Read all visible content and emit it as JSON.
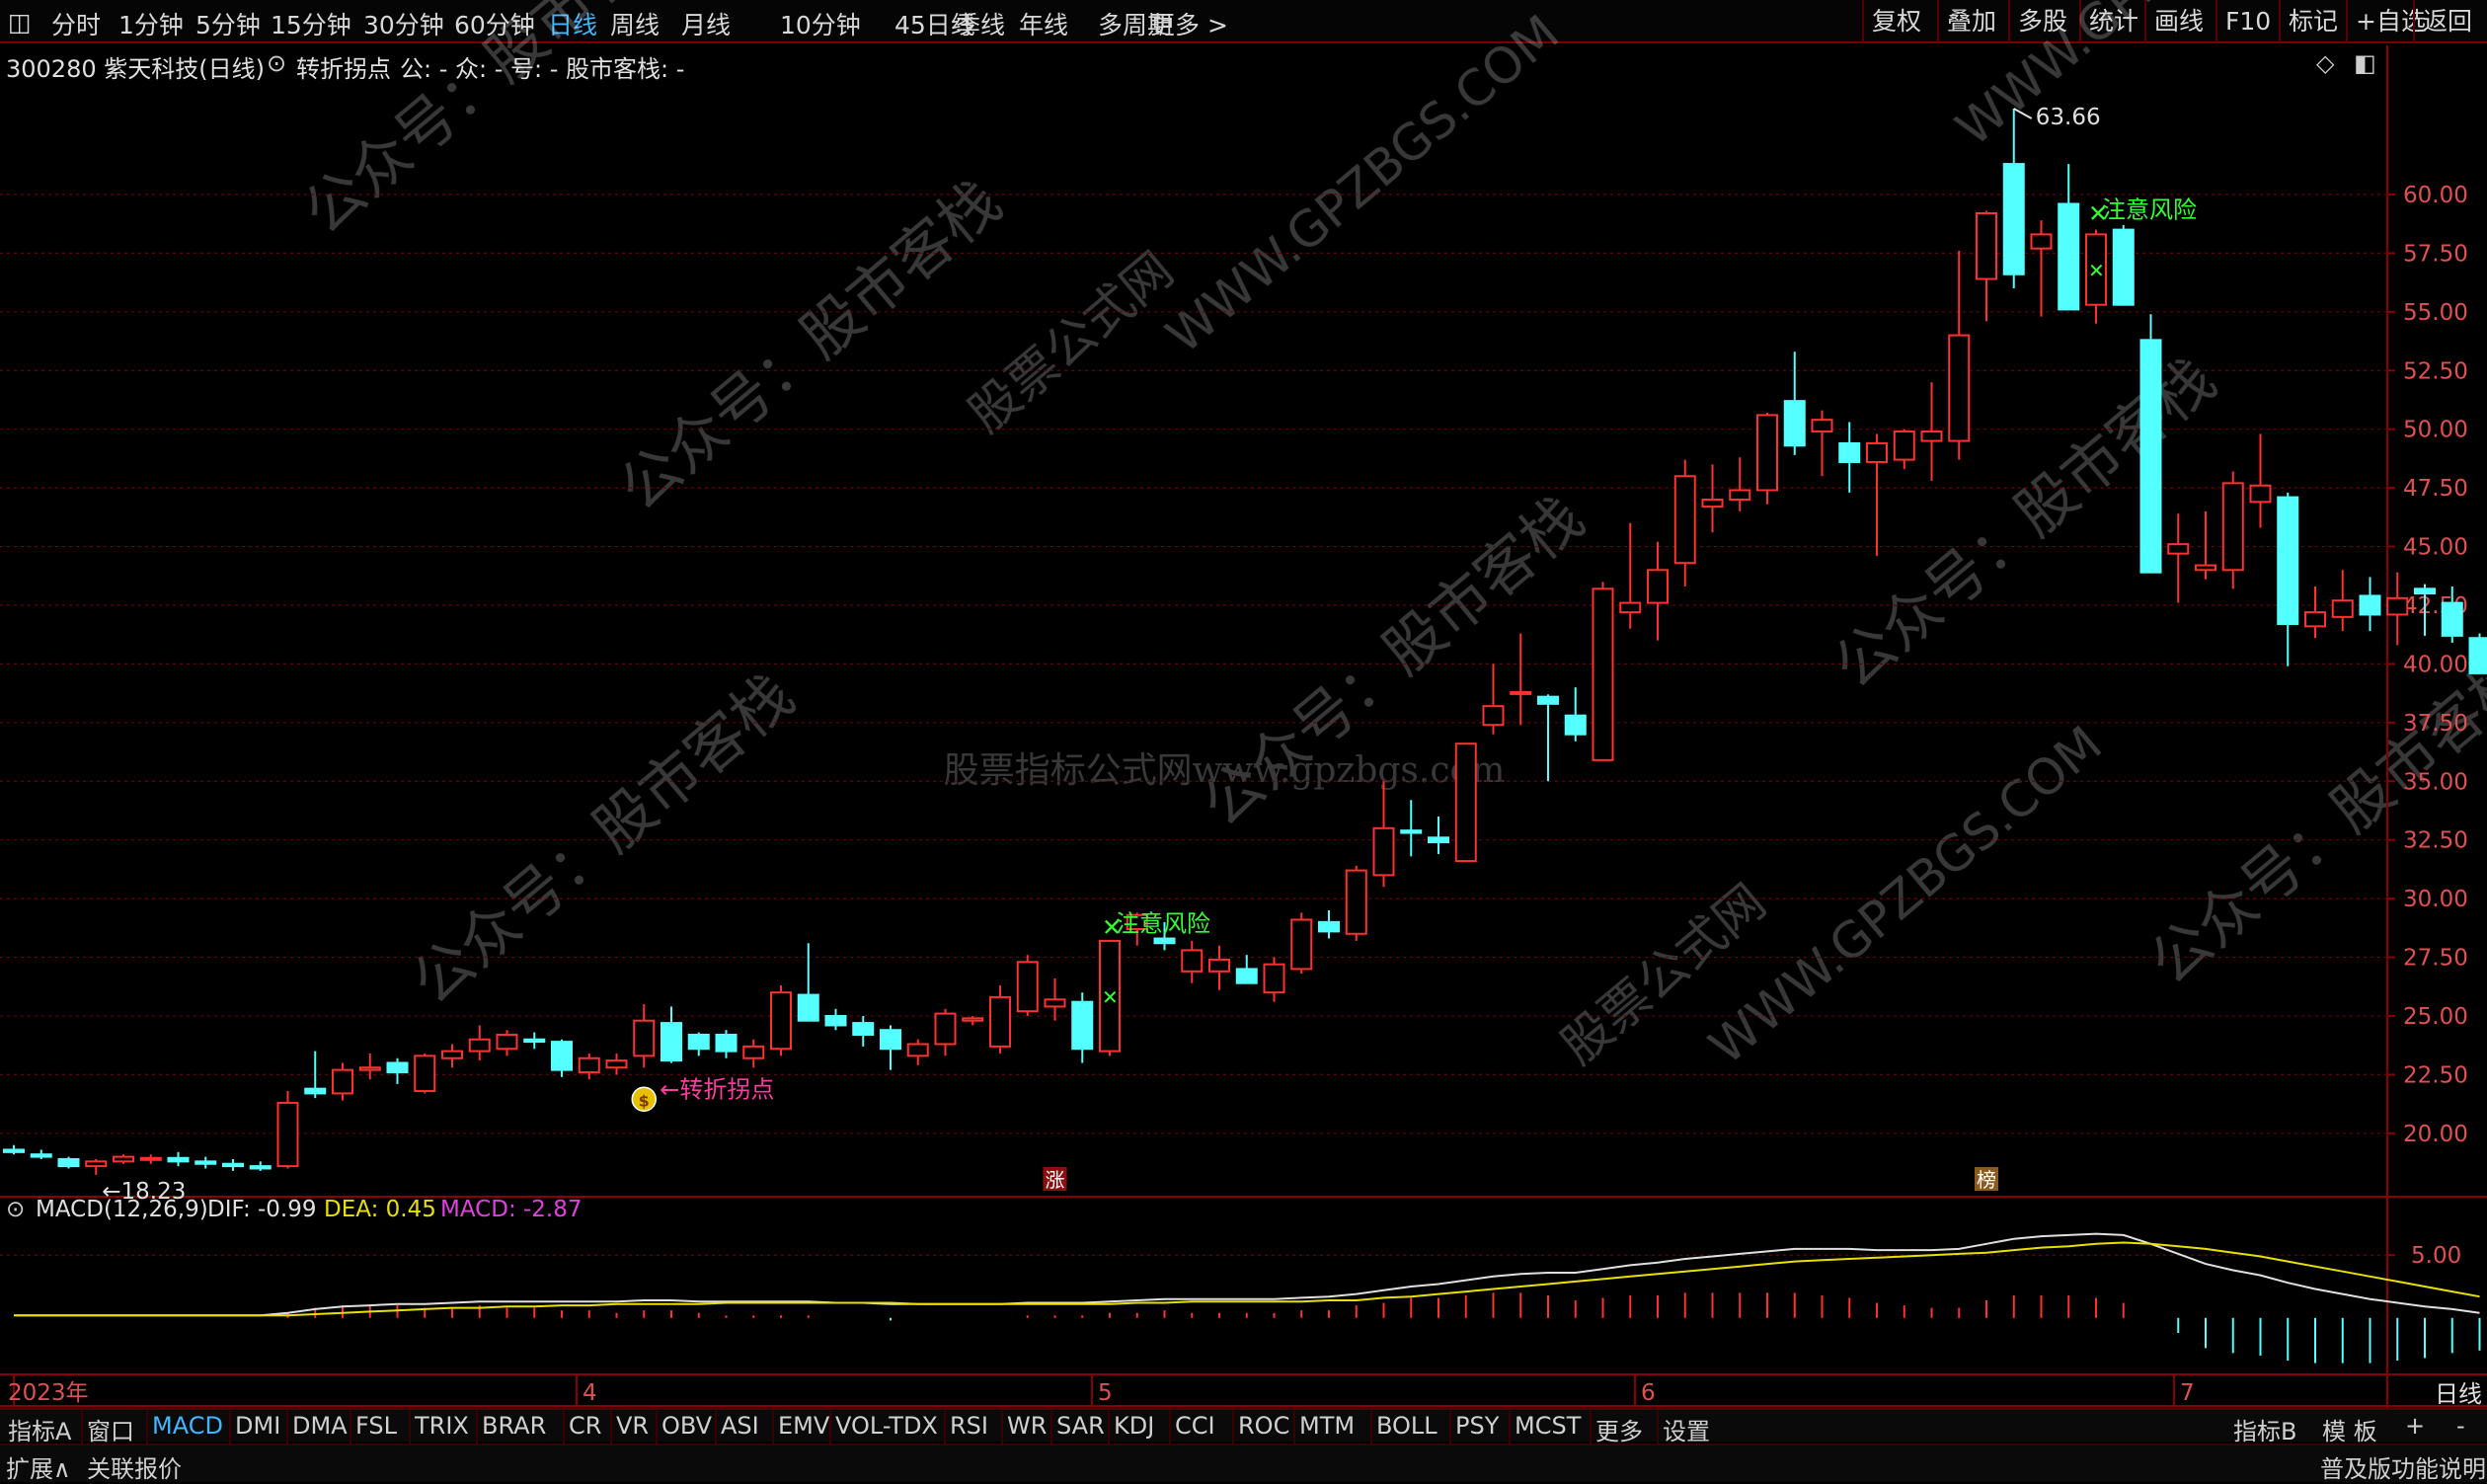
{
  "toolbar": {
    "periods": [
      "分时",
      "1分钟",
      "5分钟",
      "15分钟",
      "30分钟",
      "60分钟",
      "日线",
      "周线",
      "月线",
      "10分钟",
      "45日线",
      "季线",
      "年线",
      "多周期",
      "更多 >"
    ],
    "active_period": "日线",
    "right_buttons": [
      "复权",
      "叠加",
      "多股",
      "统计",
      "画线",
      "F10",
      "标记",
      "+自选",
      "返回"
    ]
  },
  "info": {
    "code_name": "300280 紫天科技(日线)",
    "indicator": "转折拐点",
    "fields": "公: - 众: - 号: - 股市客栈: -"
  },
  "watermarks": {
    "center": "股票指标公式网www.gpzbgs.com",
    "diag1": "公众号：股市客栈",
    "diag2": "WWW.GPZBGS.COM",
    "diag3": "股票公式网"
  },
  "chart_data": [
    {
      "type": "candlestick",
      "title": "300280 紫天科技(日线)",
      "y_ticks": [
        "20.00",
        "22.50",
        "25.00",
        "27.50",
        "30.00",
        "32.50",
        "35.00",
        "37.50",
        "40.00",
        "42.50",
        "45.00",
        "47.50",
        "50.00",
        "52.50",
        "55.00",
        "57.50",
        "60.00"
      ],
      "ylim": [
        17.3,
        64.5
      ],
      "x_month_labels": [
        "2023年",
        "4",
        "5",
        "6",
        "7"
      ],
      "candles": [
        {
          "o": 19.3,
          "h": 19.5,
          "l": 19.1,
          "c": 19.2
        },
        {
          "o": 19.1,
          "h": 19.3,
          "l": 18.9,
          "c": 19.0
        },
        {
          "o": 18.9,
          "h": 19.0,
          "l": 18.5,
          "c": 18.6
        },
        {
          "o": 18.6,
          "h": 18.9,
          "l": 18.23,
          "c": 18.8
        },
        {
          "o": 18.8,
          "h": 19.1,
          "l": 18.7,
          "c": 19.0
        },
        {
          "o": 18.9,
          "h": 19.1,
          "l": 18.7,
          "c": 18.95
        },
        {
          "o": 18.95,
          "h": 19.2,
          "l": 18.6,
          "c": 18.8
        },
        {
          "o": 18.8,
          "h": 19.0,
          "l": 18.5,
          "c": 18.7
        },
        {
          "o": 18.7,
          "h": 18.9,
          "l": 18.4,
          "c": 18.6
        },
        {
          "o": 18.6,
          "h": 18.8,
          "l": 18.4,
          "c": 18.5
        },
        {
          "o": 18.6,
          "h": 21.8,
          "l": 18.5,
          "c": 21.3
        },
        {
          "o": 21.9,
          "h": 23.5,
          "l": 21.5,
          "c": 21.7
        },
        {
          "o": 21.7,
          "h": 23.0,
          "l": 21.4,
          "c": 22.7
        },
        {
          "o": 22.7,
          "h": 23.4,
          "l": 22.3,
          "c": 22.8
        },
        {
          "o": 23.0,
          "h": 23.2,
          "l": 22.1,
          "c": 22.6
        },
        {
          "o": 21.8,
          "h": 23.4,
          "l": 21.7,
          "c": 23.3
        },
        {
          "o": 23.2,
          "h": 23.8,
          "l": 22.8,
          "c": 23.5
        },
        {
          "o": 23.5,
          "h": 24.6,
          "l": 23.1,
          "c": 24.0
        },
        {
          "o": 23.6,
          "h": 24.4,
          "l": 23.3,
          "c": 24.2
        },
        {
          "o": 24.0,
          "h": 24.3,
          "l": 23.6,
          "c": 23.9
        },
        {
          "o": 23.9,
          "h": 24.0,
          "l": 22.4,
          "c": 22.7
        },
        {
          "o": 22.6,
          "h": 23.4,
          "l": 22.3,
          "c": 23.2
        },
        {
          "o": 22.8,
          "h": 23.4,
          "l": 22.5,
          "c": 23.1
        },
        {
          "o": 23.3,
          "h": 25.5,
          "l": 22.8,
          "c": 24.8
        },
        {
          "o": 24.7,
          "h": 25.4,
          "l": 23.0,
          "c": 23.1
        },
        {
          "o": 24.2,
          "h": 24.3,
          "l": 23.3,
          "c": 23.6
        },
        {
          "o": 24.2,
          "h": 24.4,
          "l": 23.2,
          "c": 23.5
        },
        {
          "o": 23.2,
          "h": 24.0,
          "l": 22.8,
          "c": 23.7
        },
        {
          "o": 23.6,
          "h": 26.3,
          "l": 23.3,
          "c": 26.0
        },
        {
          "o": 25.9,
          "h": 28.1,
          "l": 24.8,
          "c": 24.8
        },
        {
          "o": 25.0,
          "h": 25.3,
          "l": 24.4,
          "c": 24.6
        },
        {
          "o": 24.7,
          "h": 25.0,
          "l": 23.7,
          "c": 24.2
        },
        {
          "o": 24.4,
          "h": 24.6,
          "l": 22.7,
          "c": 23.6
        },
        {
          "o": 23.3,
          "h": 24.0,
          "l": 22.9,
          "c": 23.8
        },
        {
          "o": 23.8,
          "h": 25.3,
          "l": 23.3,
          "c": 25.1
        },
        {
          "o": 24.8,
          "h": 25.0,
          "l": 24.6,
          "c": 24.9
        },
        {
          "o": 23.7,
          "h": 26.3,
          "l": 23.4,
          "c": 25.8
        },
        {
          "o": 25.2,
          "h": 27.6,
          "l": 25.0,
          "c": 27.3
        },
        {
          "o": 25.4,
          "h": 26.6,
          "l": 24.8,
          "c": 25.7
        },
        {
          "o": 25.6,
          "h": 26.0,
          "l": 23.0,
          "c": 23.6
        },
        {
          "o": 23.5,
          "h": 28.1,
          "l": 23.3,
          "c": 28.2
        },
        {
          "o": 28.7,
          "h": 29.4,
          "l": 28.0,
          "c": 29.3
        },
        {
          "o": 28.3,
          "h": 29.0,
          "l": 27.8,
          "c": 28.1
        },
        {
          "o": 26.9,
          "h": 28.2,
          "l": 26.4,
          "c": 27.8
        },
        {
          "o": 26.9,
          "h": 28.0,
          "l": 26.1,
          "c": 27.4
        },
        {
          "o": 27.0,
          "h": 27.6,
          "l": 26.5,
          "c": 26.4
        },
        {
          "o": 26.0,
          "h": 27.5,
          "l": 25.6,
          "c": 27.2
        },
        {
          "o": 27.0,
          "h": 29.4,
          "l": 26.8,
          "c": 29.1
        },
        {
          "o": 29.0,
          "h": 29.5,
          "l": 28.3,
          "c": 28.6
        },
        {
          "o": 28.5,
          "h": 31.4,
          "l": 28.2,
          "c": 31.2
        },
        {
          "o": 31.0,
          "h": 35.0,
          "l": 30.5,
          "c": 33.0
        },
        {
          "o": 32.9,
          "h": 34.2,
          "l": 31.8,
          "c": 32.8
        },
        {
          "o": 32.6,
          "h": 33.5,
          "l": 31.9,
          "c": 32.4
        },
        {
          "o": 31.6,
          "h": 36.6,
          "l": 31.6,
          "c": 36.6
        },
        {
          "o": 37.4,
          "h": 40.0,
          "l": 37.0,
          "c": 38.2
        },
        {
          "o": 38.8,
          "h": 41.3,
          "l": 37.4,
          "c": 38.8
        },
        {
          "o": 38.6,
          "h": 38.7,
          "l": 35.0,
          "c": 38.3
        },
        {
          "o": 37.8,
          "h": 39.0,
          "l": 36.7,
          "c": 37.0
        },
        {
          "o": 35.9,
          "h": 43.5,
          "l": 35.9,
          "c": 43.2
        },
        {
          "o": 42.2,
          "h": 46.0,
          "l": 41.5,
          "c": 42.6
        },
        {
          "o": 42.6,
          "h": 45.2,
          "l": 41.0,
          "c": 44.0
        },
        {
          "o": 44.3,
          "h": 48.7,
          "l": 43.3,
          "c": 48.0
        },
        {
          "o": 46.7,
          "h": 48.5,
          "l": 45.6,
          "c": 47.0
        },
        {
          "o": 47.0,
          "h": 48.8,
          "l": 46.5,
          "c": 47.4
        },
        {
          "o": 47.4,
          "h": 50.7,
          "l": 46.8,
          "c": 50.6
        },
        {
          "o": 51.2,
          "h": 53.3,
          "l": 48.9,
          "c": 49.3
        },
        {
          "o": 49.9,
          "h": 50.8,
          "l": 48.0,
          "c": 50.4
        },
        {
          "o": 49.4,
          "h": 50.3,
          "l": 47.3,
          "c": 48.6
        },
        {
          "o": 48.6,
          "h": 49.8,
          "l": 44.6,
          "c": 49.4
        },
        {
          "o": 48.7,
          "h": 50.0,
          "l": 48.3,
          "c": 49.9
        },
        {
          "o": 49.5,
          "h": 52.0,
          "l": 47.8,
          "c": 49.9
        },
        {
          "o": 49.5,
          "h": 57.6,
          "l": 48.7,
          "c": 54.0
        },
        {
          "o": 56.4,
          "h": 59.3,
          "l": 54.6,
          "c": 59.2
        },
        {
          "o": 61.3,
          "h": 63.66,
          "l": 56.0,
          "c": 56.6
        },
        {
          "o": 57.7,
          "h": 58.9,
          "l": 54.8,
          "c": 58.3
        },
        {
          "o": 59.6,
          "h": 61.3,
          "l": 55.4,
          "c": 55.1
        },
        {
          "o": 55.3,
          "h": 58.5,
          "l": 54.5,
          "c": 58.3
        },
        {
          "o": 58.5,
          "h": 58.7,
          "l": 55.3,
          "c": 55.3
        },
        {
          "o": 53.8,
          "h": 54.9,
          "l": 43.9,
          "c": 43.9
        },
        {
          "o": 44.7,
          "h": 46.4,
          "l": 42.6,
          "c": 45.1
        },
        {
          "o": 44.0,
          "h": 46.5,
          "l": 43.6,
          "c": 44.2
        },
        {
          "o": 44.0,
          "h": 48.2,
          "l": 43.2,
          "c": 47.7
        },
        {
          "o": 46.9,
          "h": 49.8,
          "l": 45.8,
          "c": 47.6
        },
        {
          "o": 47.1,
          "h": 47.3,
          "l": 39.9,
          "c": 41.7
        },
        {
          "o": 41.6,
          "h": 43.3,
          "l": 41.1,
          "c": 42.2
        },
        {
          "o": 42.0,
          "h": 44.0,
          "l": 41.4,
          "c": 42.7
        },
        {
          "o": 42.9,
          "h": 43.7,
          "l": 41.4,
          "c": 42.1
        },
        {
          "o": 42.1,
          "h": 43.9,
          "l": 40.8,
          "c": 42.8
        },
        {
          "o": 43.2,
          "h": 43.4,
          "l": 41.2,
          "c": 43.0
        },
        {
          "o": 42.6,
          "h": 43.3,
          "l": 40.9,
          "c": 41.2
        },
        {
          "o": 41.1,
          "h": 41.3,
          "l": 39.6,
          "c": 39.6
        }
      ],
      "annotations": [
        {
          "text": "63.66",
          "kind": "high",
          "index": 73
        },
        {
          "text": "18.23",
          "kind": "low",
          "index": 3
        },
        {
          "text": "转折拐点",
          "kind": "turning-point",
          "index": 23
        },
        {
          "text": "注意风险",
          "kind": "risk",
          "index": 40
        },
        {
          "text": "注意风险",
          "kind": "risk",
          "index": 76
        },
        {
          "text": "涨",
          "kind": "badge",
          "index": 38
        },
        {
          "text": "榜",
          "kind": "badge",
          "index": 72
        }
      ]
    },
    {
      "type": "line",
      "title": "MACD(12,26,9)",
      "labels": {
        "name": "MACD(12,26,9)",
        "dif": "DIF: -0.99",
        "dea": "DEA: 0.45",
        "macd": "MACD: -2.87"
      },
      "y_ticks": [
        "5.00"
      ],
      "ylim": [
        -4.5,
        9.5
      ],
      "series": [
        {
          "name": "DIF",
          "color": "#e0e0e0",
          "values": [
            0.2,
            0.2,
            0.2,
            0.2,
            0.2,
            0.2,
            0.2,
            0.2,
            0.2,
            0.2,
            0.4,
            0.7,
            0.9,
            1.0,
            1.1,
            1.1,
            1.2,
            1.3,
            1.3,
            1.3,
            1.3,
            1.3,
            1.3,
            1.4,
            1.4,
            1.3,
            1.3,
            1.3,
            1.3,
            1.3,
            1.2,
            1.2,
            1.1,
            1.1,
            1.1,
            1.1,
            1.1,
            1.2,
            1.2,
            1.2,
            1.3,
            1.4,
            1.5,
            1.5,
            1.5,
            1.5,
            1.5,
            1.6,
            1.7,
            1.9,
            2.2,
            2.5,
            2.7,
            3.0,
            3.3,
            3.5,
            3.6,
            3.6,
            3.9,
            4.2,
            4.4,
            4.7,
            4.9,
            5.1,
            5.3,
            5.5,
            5.5,
            5.5,
            5.4,
            5.4,
            5.4,
            5.5,
            5.9,
            6.3,
            6.5,
            6.6,
            6.7,
            6.6,
            5.9,
            5.1,
            4.3,
            3.8,
            3.4,
            2.8,
            2.3,
            1.9,
            1.5,
            1.2,
            0.9,
            0.7,
            0.4
          ]
        },
        {
          "name": "DEA",
          "color": "#e8e000",
          "values": [
            0.2,
            0.2,
            0.2,
            0.2,
            0.2,
            0.2,
            0.2,
            0.2,
            0.2,
            0.2,
            0.2,
            0.3,
            0.4,
            0.5,
            0.6,
            0.7,
            0.8,
            0.8,
            0.9,
            0.9,
            1.0,
            1.0,
            1.1,
            1.1,
            1.1,
            1.1,
            1.2,
            1.2,
            1.2,
            1.2,
            1.2,
            1.2,
            1.2,
            1.1,
            1.1,
            1.1,
            1.1,
            1.1,
            1.1,
            1.1,
            1.1,
            1.2,
            1.2,
            1.3,
            1.3,
            1.3,
            1.3,
            1.3,
            1.4,
            1.4,
            1.6,
            1.7,
            1.9,
            2.1,
            2.3,
            2.5,
            2.7,
            2.9,
            3.1,
            3.3,
            3.5,
            3.7,
            3.9,
            4.1,
            4.3,
            4.5,
            4.6,
            4.7,
            4.8,
            4.9,
            5.0,
            5.1,
            5.2,
            5.4,
            5.6,
            5.7,
            5.9,
            6.0,
            5.9,
            5.7,
            5.5,
            5.2,
            4.9,
            4.5,
            4.1,
            3.7,
            3.3,
            2.9,
            2.5,
            2.1,
            1.7
          ]
        }
      ],
      "bars": [
        0,
        0,
        0,
        0,
        0,
        0,
        0,
        0,
        0,
        0,
        0.4,
        0.8,
        1.0,
        1.0,
        1.0,
        0.8,
        0.8,
        1.0,
        0.8,
        0.8,
        0.6,
        0.6,
        0.4,
        0.6,
        0.6,
        0.4,
        0.2,
        0.2,
        0.2,
        0.2,
        0,
        0,
        -0.2,
        0,
        0,
        0,
        0,
        0.2,
        0.2,
        0.2,
        0.4,
        0.4,
        0.6,
        0.4,
        0.4,
        0.4,
        0.4,
        0.6,
        0.6,
        1.0,
        1.2,
        1.6,
        1.6,
        1.8,
        2.0,
        2.0,
        1.8,
        1.4,
        1.6,
        1.8,
        1.8,
        2.0,
        2.0,
        2.0,
        2.0,
        2.0,
        1.8,
        1.6,
        1.2,
        1.0,
        0.8,
        0.8,
        1.4,
        1.8,
        1.8,
        1.8,
        1.6,
        1.2,
        0,
        -1.2,
        -2.4,
        -2.8,
        -3.0,
        -3.4,
        -3.6,
        -3.6,
        -3.6,
        -3.4,
        -3.2,
        -2.8,
        -2.6
      ]
    }
  ],
  "ind_tabs": [
    "指标A",
    "窗口",
    "MACD",
    "DMI",
    "DMA",
    "FSL",
    "TRIX",
    "BRAR",
    "CR",
    "VR",
    "OBV",
    "ASI",
    "EMV",
    "VOL-TDX",
    "RSI",
    "WR",
    "SAR",
    "KDJ",
    "CCI",
    "ROC",
    "MTM",
    "BOLL",
    "PSY",
    "MCST",
    "更多",
    "设置"
  ],
  "active_tab": "MACD",
  "ind_right": [
    "指标B",
    "模 板",
    "+",
    "-"
  ],
  "bottom": {
    "left1": "扩展∧",
    "left2": "关联报价",
    "right": "普及版功能说明",
    "period": "日线"
  },
  "colors": {
    "up": "#ff3030",
    "down": "#54ffff",
    "grid": "#6a0000",
    "frame": "#8a0000",
    "risk": "#33ff33",
    "turn": "#ff3aa0"
  }
}
